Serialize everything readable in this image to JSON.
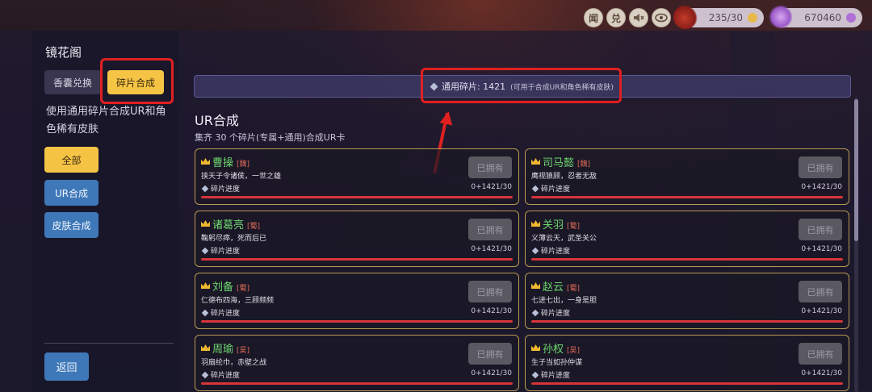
{
  "topbar": {
    "buttons": [
      {
        "label": "闻",
        "icon": "news-icon"
      },
      {
        "label": "兑",
        "icon": "exchange-icon"
      },
      {
        "label": "",
        "icon": "mute-icon"
      },
      {
        "label": "",
        "icon": "eye-icon"
      }
    ],
    "resources": [
      {
        "value": "235/30",
        "icon": "stamina-bag-icon",
        "coin_color": "#e8b84a"
      },
      {
        "value": "670460",
        "icon": "crystal-currency-icon",
        "coin_color": "#b070d8"
      }
    ]
  },
  "sidebar": {
    "title": "镜花阁",
    "tabs": [
      {
        "label": "香囊兑换",
        "active": false
      },
      {
        "label": "碎片合成",
        "active": true
      }
    ],
    "description": "使用通用碎片合成UR和角色稀有皮肤",
    "filters": [
      {
        "label": "全部",
        "active": true
      },
      {
        "label": "UR合成",
        "active": false
      },
      {
        "label": "皮肤合成",
        "active": false
      }
    ],
    "back_label": "返回"
  },
  "banner": {
    "label": "通用碎片: 1421",
    "note": "(可用于合成UR和角色稀有皮肤)"
  },
  "section": {
    "title": "UR合成",
    "subtitle": "集齐 30 个碎片(专属+通用)合成UR卡"
  },
  "cards": [
    {
      "name": "曹操",
      "faction": "[魏]",
      "desc": "挟天子令诸侯，一世之雄",
      "progress_label": "碎片进度",
      "progress": "0+1421/30",
      "progress_fraction": 1.0,
      "button": "已拥有"
    },
    {
      "name": "司马懿",
      "faction": "[魏]",
      "desc": "鹰视狼顾，忍者无敌",
      "progress_label": "碎片进度",
      "progress": "0+1421/30",
      "progress_fraction": 1.0,
      "button": "已拥有"
    },
    {
      "name": "诸葛亮",
      "faction": "[蜀]",
      "desc": "鞠躬尽瘁，死而后已",
      "progress_label": "碎片进度",
      "progress": "0+1421/30",
      "progress_fraction": 1.0,
      "button": "已拥有"
    },
    {
      "name": "关羽",
      "faction": "[蜀]",
      "desc": "义薄云天，武圣关公",
      "progress_label": "碎片进度",
      "progress": "0+1421/30",
      "progress_fraction": 1.0,
      "button": "已拥有"
    },
    {
      "name": "刘备",
      "faction": "[蜀]",
      "desc": "仁德布四海，三顾频频",
      "progress_label": "碎片进度",
      "progress": "0+1421/30",
      "progress_fraction": 1.0,
      "button": "已拥有"
    },
    {
      "name": "赵云",
      "faction": "[蜀]",
      "desc": "七进七出，一身是胆",
      "progress_label": "碎片进度",
      "progress": "0+1421/30",
      "progress_fraction": 1.0,
      "button": "已拥有"
    },
    {
      "name": "周瑜",
      "faction": "[吴]",
      "desc": "羽扇纶巾，赤壁之战",
      "progress_label": "碎片进度",
      "progress": "0+1421/30",
      "progress_fraction": 1.0,
      "button": "已拥有"
    },
    {
      "name": "孙权",
      "faction": "[吴]",
      "desc": "生子当如孙仲谋",
      "progress_label": "碎片进度",
      "progress": "0+1421/30",
      "progress_fraction": 1.0,
      "button": "已拥有"
    }
  ]
}
